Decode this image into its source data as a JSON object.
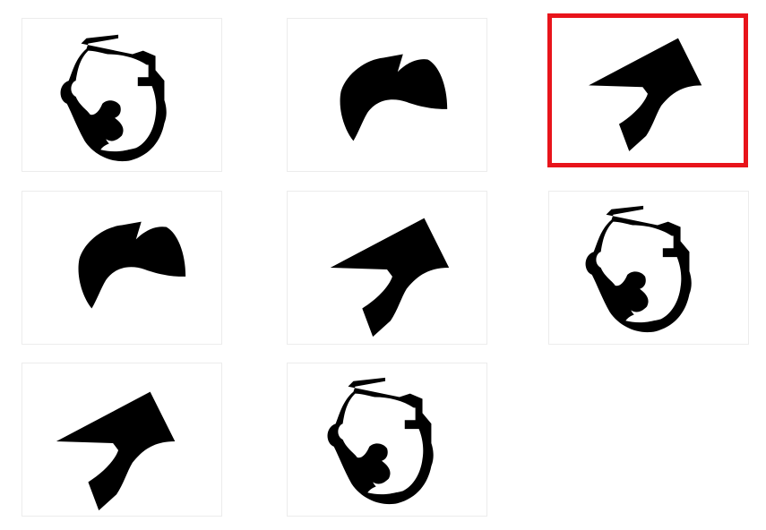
{
  "grid": {
    "highlight_color": "#e8141b",
    "tiles": [
      {
        "row": 1,
        "col": 1,
        "shape": "face-with-ear-shape",
        "selected": false
      },
      {
        "row": 1,
        "col": 2,
        "shape": "dome-notch-shape",
        "selected": false
      },
      {
        "row": 1,
        "col": 3,
        "shape": "arrowhead-shape",
        "selected": true
      },
      {
        "row": 2,
        "col": 1,
        "shape": "dome-notch-shape",
        "selected": false
      },
      {
        "row": 2,
        "col": 2,
        "shape": "arrowhead-shape",
        "selected": false
      },
      {
        "row": 2,
        "col": 3,
        "shape": "face-with-ear-shape",
        "selected": false
      },
      {
        "row": 3,
        "col": 1,
        "shape": "arrowhead-shape",
        "selected": false
      },
      {
        "row": 3,
        "col": 2,
        "shape": "face-with-ear-shape",
        "selected": false
      }
    ]
  }
}
